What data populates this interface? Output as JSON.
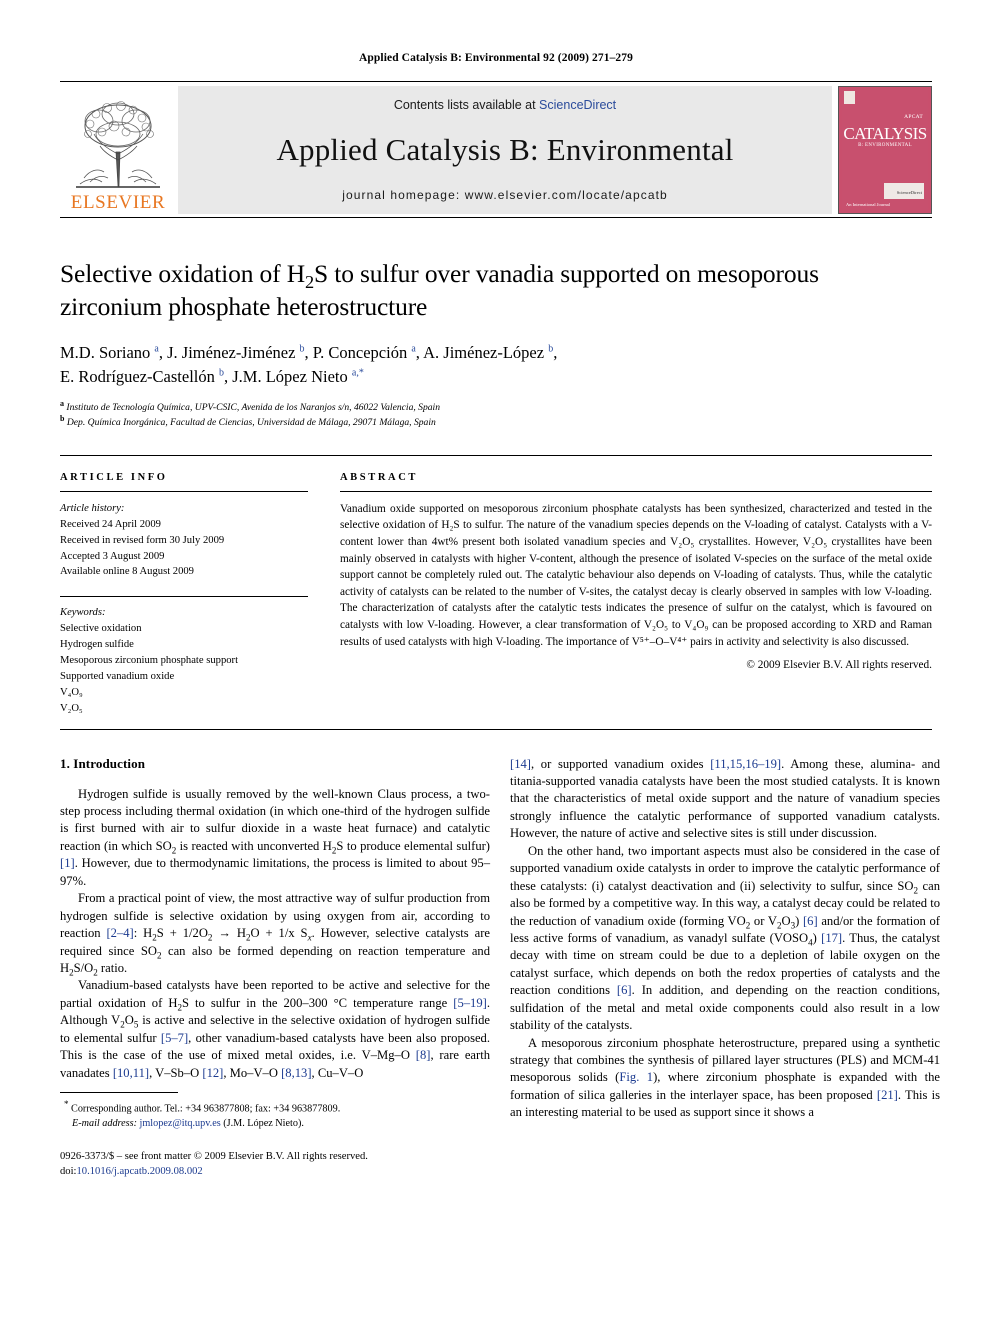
{
  "running_head": "Applied Catalysis B: Environmental 92 (2009) 271–279",
  "masthead": {
    "contents_prefix": "Contents lists available at ",
    "sciencedirect": "ScienceDirect",
    "journal_title": "Applied Catalysis B: Environmental",
    "homepage": "journal homepage: www.elsevier.com/locate/apcatb",
    "publisher_name": "ELSEVIER",
    "cover": {
      "word": "CATALYSIS",
      "label_top": "APCAT",
      "subtitle": "B: ENVIRONMENTAL",
      "box_caption": "ScienceDirect",
      "bottom_caption": "An International Journal"
    },
    "accent_orange": "#E87722",
    "link_blue": "#2a4b9b"
  },
  "article": {
    "title_line1": "Selective oxidation of H₂S to sulfur over vanadia supported on mesoporous",
    "title_line2": "zirconium phosphate heterostructure",
    "authors_line1": "M.D. Soriano a, J. Jiménez-Jiménez b, P. Concepción a, A. Jiménez-López b,",
    "authors_line2": "E. Rodríguez-Castellón b, J.M. López Nieto a,*",
    "affiliation_a": "Instituto de Tecnología Química, UPV-CSIC, Avenida de los Naranjos s/n, 46022 Valencia, Spain",
    "affiliation_b": "Dep. Química Inorgánica, Facultad de Ciencias, Universidad de Málaga, 29071 Málaga, Spain"
  },
  "info": {
    "heading": "ARTICLE INFO",
    "history_label": "Article history:",
    "history": [
      "Received 24 April 2009",
      "Received in revised form 30 July 2009",
      "Accepted 3 August 2009",
      "Available online 8 August 2009"
    ],
    "keywords_label": "Keywords:",
    "keywords": [
      "Selective oxidation",
      "Hydrogen sulfide",
      "Mesoporous zirconium phosphate support",
      "Supported vanadium oxide",
      "V₄O₉",
      "V₂O₅"
    ]
  },
  "abstract": {
    "heading": "ABSTRACT",
    "text": "Vanadium oxide supported on mesoporous zirconium phosphate catalysts has been synthesized, characterized and tested in the selective oxidation of H₂S to sulfur. The nature of the vanadium species depends on the V-loading of catalyst. Catalysts with a V-content lower than 4wt% present both isolated vanadium species and V₂O₅ crystallites. However, V₂O₅ crystallites have been mainly observed in catalysts with higher V-content, although the presence of isolated V-species on the surface of the metal oxide support cannot be completely ruled out. The catalytic behaviour also depends on V-loading of catalysts. Thus, while the catalytic activity of catalysts can be related to the number of V-sites, the catalyst decay is clearly observed in samples with low V-loading. The characterization of catalysts after the catalytic tests indicates the presence of sulfur on the catalyst, which is favoured on catalysts with low V-loading. However, a clear transformation of V₂O₅ to V₄O₉ can be proposed according to XRD and Raman results of used catalysts with high V-loading. The importance of V⁵⁺–O–V⁴⁺ pairs in activity and selectivity is also discussed.",
    "copyright": "© 2009 Elsevier B.V. All rights reserved."
  },
  "introduction": {
    "heading": "1. Introduction",
    "para1": "Hydrogen sulfide is usually removed by the well-known Claus process, a two-step process including thermal oxidation (in which one-third of the hydrogen sulfide is first burned with air to sulfur dioxide in a waste heat furnace) and catalytic reaction (in which SO2 is reacted with unconverted H2S to produce elemental sulfur) [1]. However, due to thermodynamic limitations, the process is limited to about 95–97%.",
    "para2": "From a practical point of view, the most attractive way of sulfur production from hydrogen sulfide is selective oxidation by using oxygen from air, according to reaction [2–4]: H2S + 1/2O2 → H2O + 1/x Sx. However, selective catalysts are required since SO2 can also be formed depending on reaction temperature and H2S/O2 ratio.",
    "para3": "Vanadium-based catalysts have been reported to be active and selective for the partial oxidation of H2S to sulfur in the 200–300 °C temperature range [5–19]. Although V2O5 is active and selective in the selective oxidation of hydrogen sulfide to elemental sulfur [5–7], other vanadium-based catalysts have been also proposed. This is the case of the use of mixed metal oxides, i.e. V–Mg–O [8], rare earth vanadates [10,11], V–Sb–O [12], Mo–V–O [8,13], Cu–V–O",
    "para4": "[14], or supported vanadium oxides [11,15,16–19]. Among these, alumina- and titania-supported vanadia catalysts have been the most studied catalysts. It is known that the characteristics of metal oxide support and the nature of vanadium species strongly influence the catalytic performance of supported vanadium catalysts. However, the nature of active and selective sites is still under discussion.",
    "para5": "On the other hand, two important aspects must also be considered in the case of supported vanadium oxide catalysts in order to improve the catalytic performance of these catalysts: (i) catalyst deactivation and (ii) selectivity to sulfur, since SO2 can also be formed by a competitive way. In this way, a catalyst decay could be related to the reduction of vanadium oxide (forming VO2 or V2O3) [6] and/or the formation of less active forms of vanadium, as vanadyl sulfate (VOSO4) [17]. Thus, the catalyst decay with time on stream could be due to a depletion of labile oxygen on the catalyst surface, which depends on both the redox properties of catalysts and the reaction conditions [6]. In addition, and depending on the reaction conditions, sulfidation of the metal and metal oxide components could also result in a low stability of the catalysts.",
    "para6": "A mesoporous zirconium phosphate heterostructure, prepared using a synthetic strategy that combines the synthesis of pillared layer structures (PLS) and MCM-41 mesoporous solids (Fig. 1), where zirconium phosphate is expanded with the formation of silica galleries in the interlayer space, has been proposed [21]. This is an interesting material to be used as support since it shows a"
  },
  "footnotes": {
    "corresponding": "Corresponding author. Tel.: +34 963877808; fax: +34 963877809.",
    "email_label": "E-mail address:",
    "email": "jmlopez@itq.upv.es",
    "email_owner": "(J.M. López Nieto)."
  },
  "footer": {
    "issn_line": "0926-3373/$ – see front matter © 2009 Elsevier B.V. All rights reserved.",
    "doi_label": "doi:",
    "doi": "10.1016/j.apcatb.2009.08.002"
  }
}
